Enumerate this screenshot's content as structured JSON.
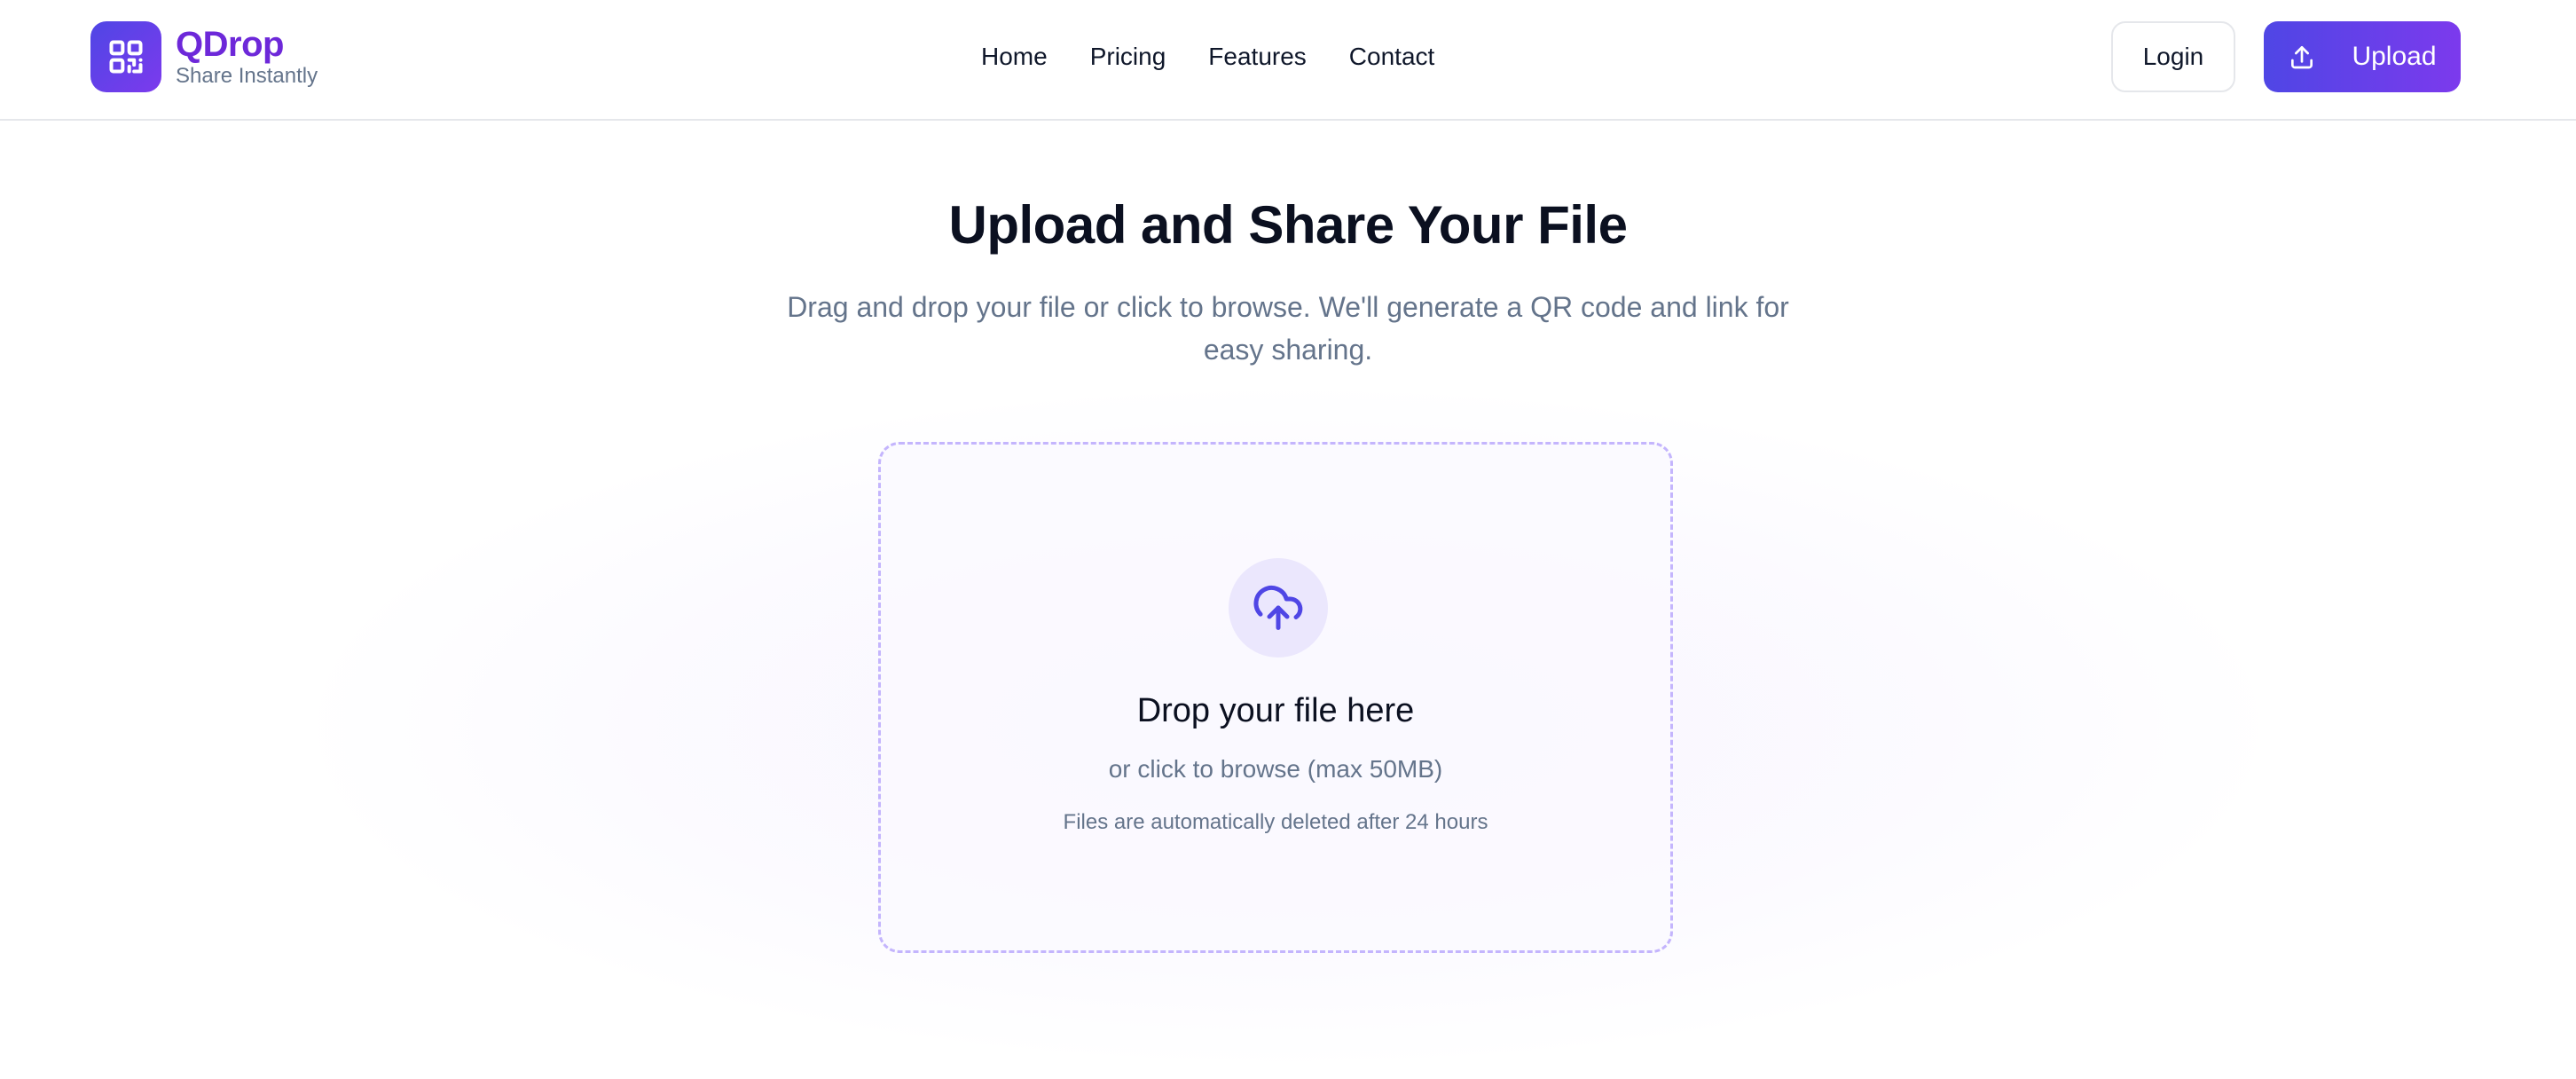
{
  "brand": {
    "name": "QDrop",
    "tagline": "Share Instantly",
    "logo_icon": "qr-code-icon",
    "colors": {
      "gradient_start": "#4f46e5",
      "gradient_end": "#7c3aed",
      "name_color": "#6d28d9"
    }
  },
  "nav": {
    "items": [
      {
        "label": "Home"
      },
      {
        "label": "Pricing"
      },
      {
        "label": "Features"
      },
      {
        "label": "Contact"
      }
    ]
  },
  "header_actions": {
    "login_label": "Login",
    "upload_label": "Upload",
    "upload_icon": "upload-icon"
  },
  "hero": {
    "title": "Upload and Share Your File",
    "subtitle": "Drag and drop your file or click to browse. We'll generate a QR code and link for easy sharing."
  },
  "dropzone": {
    "icon": "cloud-upload-icon",
    "title": "Drop your file here",
    "subtitle": "or click to browse (max 50MB)",
    "note": "Files are automatically deleted after 24 hours",
    "colors": {
      "border": "#c4b5fd",
      "icon_bg": "#ebe7fd",
      "icon": "#4f46e5"
    }
  }
}
